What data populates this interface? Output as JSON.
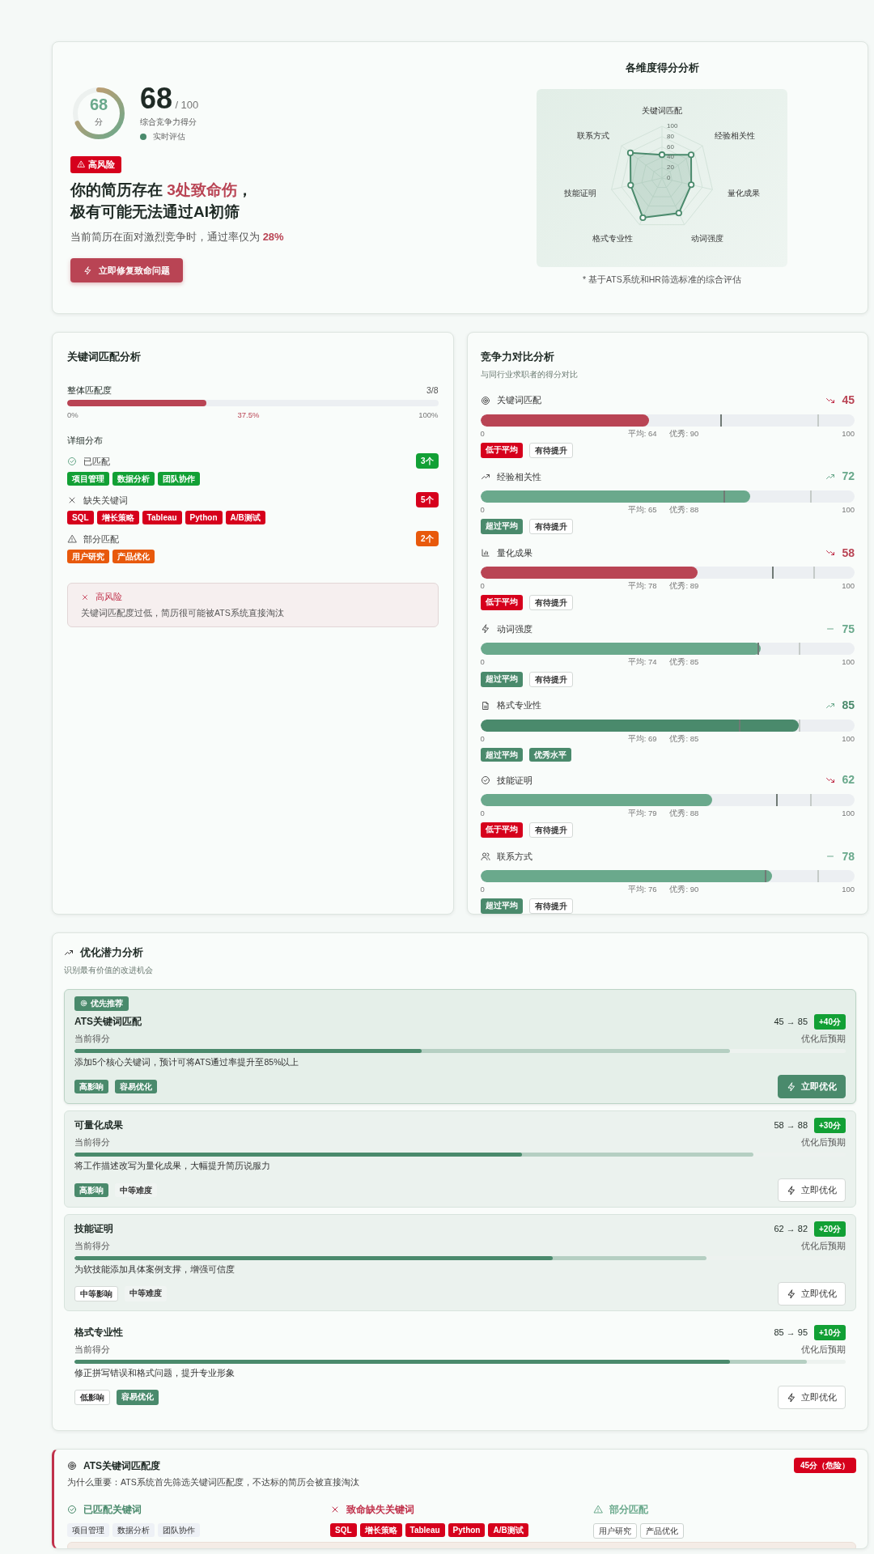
{
  "overview": {
    "ring": {
      "score": "68",
      "unit": "分",
      "level": 0.68
    },
    "score": "68",
    "score_max": "/ 100",
    "score_label": "综合竞争力得分",
    "live_label": "实时评估",
    "risk_badge": "高风险",
    "headline": [
      "你的简历存在 **3处致命伤**，",
      "极有可能无法通过AI初筛"
    ],
    "pass_rate_text": "当前简历在面对激烈竞争时，通过率仅为 **28%**",
    "fix_button": "立即修复致命问题",
    "radar": {
      "title": "各维度得分分析",
      "axes": [
        "关键词匹配",
        "经验相关性",
        "量化成果",
        "动词强度",
        "格式专业性",
        "技能证明",
        "联系方式"
      ],
      "ticks": [
        "100",
        "80",
        "60",
        "40",
        "20",
        "0"
      ],
      "footnote": "* 基于ATS系统和HR筛选标准的综合评估"
    }
  },
  "keyword_match": {
    "title": "关键词匹配分析",
    "overall_label": "整体匹配度",
    "ratio": "3/8",
    "level": 0.375,
    "scale": [
      "0%",
      "37.5%",
      "100%"
    ],
    "detail_title": "详细分布",
    "groups": [
      {
        "kind": "matched",
        "label": "已匹配",
        "count": "3个",
        "keywords": [
          "项目管理",
          "数据分析",
          "团队协作"
        ]
      },
      {
        "kind": "missing",
        "label": "缺失关键词",
        "count": "5个",
        "keywords": [
          "SQL",
          "增长策略",
          "Tableau",
          "Python",
          "A/B测试"
        ]
      },
      {
        "kind": "partial",
        "label": "部分匹配",
        "count": "2个",
        "keywords": [
          "用户研究",
          "产品优化"
        ]
      }
    ],
    "alert": {
      "title": "高风险",
      "text": "关键词匹配度过低，简历很可能被ATS系统直接淘汰"
    }
  },
  "competition": {
    "title": "竞争力对比分析",
    "subtitle": "与同行业求职者的得分对比",
    "items": [
      {
        "name": "关键词匹配",
        "kind": "down",
        "score": "45",
        "level": 0.45,
        "color": "#b94454",
        "scale_min": "0",
        "average": "平均: 64",
        "excellent": "优秀: 90",
        "scale_max": "100",
        "tags": [
          {
            "label": "低于平均",
            "kind": "danger"
          },
          {
            "label": "有待提升",
            "kind": "outline"
          }
        ]
      },
      {
        "name": "经验相关性",
        "kind": "up",
        "score": "72",
        "level": 0.72,
        "color": "#6aa98c",
        "scale_min": "0",
        "average": "平均: 65",
        "excellent": "优秀: 88",
        "scale_max": "100",
        "tags": [
          {
            "label": "超过平均",
            "kind": "success"
          },
          {
            "label": "有待提升",
            "kind": "outline"
          }
        ]
      },
      {
        "name": "量化成果",
        "kind": "down",
        "score": "58",
        "level": 0.58,
        "color": "#b94454",
        "scale_min": "0",
        "average": "平均: 78",
        "excellent": "优秀: 89",
        "scale_max": "100",
        "tags": [
          {
            "label": "低于平均",
            "kind": "danger"
          },
          {
            "label": "有待提升",
            "kind": "outline"
          }
        ]
      },
      {
        "name": "动词强度",
        "kind": "flat",
        "score": "75",
        "level": 0.75,
        "color": "#6aa98c",
        "scale_min": "0",
        "average": "平均: 74",
        "excellent": "优秀: 85",
        "scale_max": "100",
        "tags": [
          {
            "label": "超过平均",
            "kind": "success"
          },
          {
            "label": "有待提升",
            "kind": "outline"
          }
        ]
      },
      {
        "name": "格式专业性",
        "kind": "up",
        "score": "85",
        "level": 0.85,
        "color": "#4a8a6c",
        "scale_min": "0",
        "average": "平均: 69",
        "excellent": "优秀: 85",
        "scale_max": "100",
        "tags": [
          {
            "label": "超过平均",
            "kind": "success"
          },
          {
            "label": "优秀水平",
            "kind": "success"
          }
        ]
      },
      {
        "name": "技能证明",
        "kind": "down",
        "score": "62",
        "level": 0.62,
        "color": "#6aa98c",
        "scale_min": "0",
        "average": "平均: 79",
        "excellent": "优秀: 88",
        "scale_max": "100",
        "tags": [
          {
            "label": "低于平均",
            "kind": "danger"
          },
          {
            "label": "有待提升",
            "kind": "outline"
          }
        ]
      },
      {
        "name": "联系方式",
        "kind": "flat",
        "score": "78",
        "level": 0.78,
        "color": "#6aa98c",
        "scale_min": "0",
        "average": "平均: 76",
        "excellent": "优秀: 90",
        "scale_max": "100",
        "tags": [
          {
            "label": "超过平均",
            "kind": "success"
          },
          {
            "label": "有待提升",
            "kind": "outline"
          }
        ]
      }
    ]
  },
  "optimization": {
    "title": "优化潜力分析",
    "subtitle": "识别最有价值的改进机会",
    "items": [
      {
        "kind": "priority",
        "badge": "优先推荐",
        "name": "ATS关键词匹配",
        "score_change": "45 → 85",
        "gain": "+40分",
        "current_label": "当前得分",
        "expected_label": "优化后预期",
        "description": "添加5个核心关键词，预计可将ATS通过率提升至85%以上",
        "tags": [
          {
            "label": "高影响",
            "kind": "strong"
          },
          {
            "label": "容易优化",
            "kind": "strong"
          }
        ],
        "button": {
          "label": "立即优化",
          "primary": true
        }
      },
      {
        "kind": "tinted",
        "name": "可量化成果",
        "score_change": "58 → 88",
        "gain": "+30分",
        "current_label": "当前得分",
        "expected_label": "优化后预期",
        "description": "将工作描述改写为量化成果，大幅提升简历说服力",
        "tags": [
          {
            "label": "高影响",
            "kind": "strong"
          },
          {
            "label": "中等难度",
            "kind": "muted"
          }
        ],
        "button": {
          "label": "立即优化",
          "primary": false
        }
      },
      {
        "kind": "tinted",
        "name": "技能证明",
        "score_change": "62 → 82",
        "gain": "+20分",
        "current_label": "当前得分",
        "expected_label": "优化后预期",
        "description": "为软技能添加具体案例支撑，增强可信度",
        "tags": [
          {
            "label": "中等影响",
            "kind": "outline"
          },
          {
            "label": "中等难度",
            "kind": "muted"
          }
        ],
        "button": {
          "label": "立即优化",
          "primary": false
        }
      },
      {
        "kind": "plain",
        "name": "格式专业性",
        "score_change": "85 → 95",
        "gain": "+10分",
        "current_label": "当前得分",
        "expected_label": "优化后预期",
        "description": "修正拼写错误和格式问题，提升专业形象",
        "tags": [
          {
            "label": "低影响",
            "kind": "outline"
          },
          {
            "label": "容易优化",
            "kind": "strong"
          }
        ],
        "button": {
          "label": "立即优化",
          "primary": false
        }
      }
    ]
  },
  "ats": {
    "title": "ATS关键词匹配度",
    "badge": "45分（危险）",
    "why": "为什么重要：ATS系统首先筛选关键词匹配度，不达标的简历会被直接淘汰",
    "groups": [
      {
        "kind": "matched",
        "label": "已匹配关键词",
        "keywords": [
          "项目管理",
          "数据分析",
          "团队协作"
        ]
      },
      {
        "kind": "missing",
        "label": "致命缺失关键词",
        "keywords": [
          "SQL",
          "增长策略",
          "Tableau",
          "Python",
          "A/B测试"
        ]
      },
      {
        "kind": "partial",
        "label": "部分匹配",
        "keywords": [
          "用户研究",
          "产品优化"
        ]
      }
    ]
  }
}
